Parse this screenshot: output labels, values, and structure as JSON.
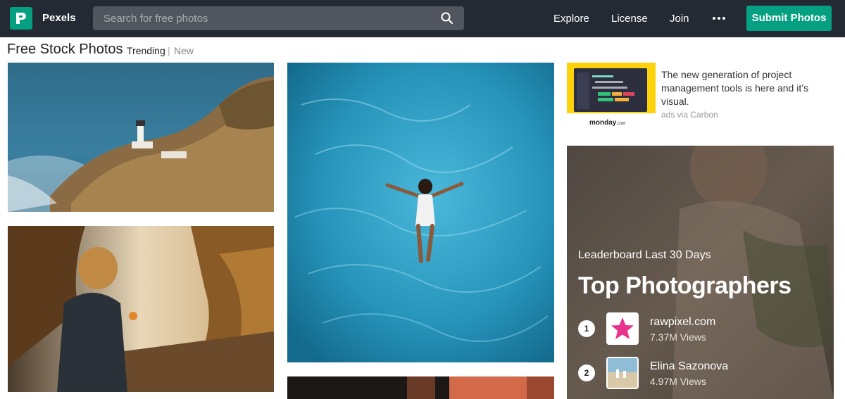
{
  "topbar": {
    "brand": "Pexels",
    "search_placeholder": "Search for free photos",
    "nav": [
      "Explore",
      "License",
      "Join"
    ],
    "more_icon": "ellipsis-icon",
    "submit_label": "Submit Photos",
    "colors": {
      "bar": "#232a34",
      "accent": "#05a081"
    }
  },
  "subheader": {
    "title": "Free Stock Photos",
    "filter_active": "Trending",
    "separator": "|",
    "filter_other": "New"
  },
  "photos": [
    {
      "name": "lighthouse-coast-photo"
    },
    {
      "name": "woman-in-autumn-photo"
    },
    {
      "name": "swimmer-in-pool-photo"
    },
    {
      "name": "dark-orange-photo"
    }
  ],
  "ad": {
    "text": "The new generation of project management tools is here and it’s visual.",
    "via": "ads via Carbon",
    "logo_text": "monday",
    "logo_suffix": ".com"
  },
  "leaderboard": {
    "subtitle": "Leaderboard Last 30 Days",
    "title": "Top Photographers",
    "photographers": [
      {
        "rank": "1",
        "name": "rawpixel.com",
        "views": "7.37M Views",
        "avatar": "pink-star-icon"
      },
      {
        "rank": "2",
        "name": "Elina Sazonova",
        "views": "4.97M Views",
        "avatar": "beach-photo-avatar"
      }
    ]
  }
}
